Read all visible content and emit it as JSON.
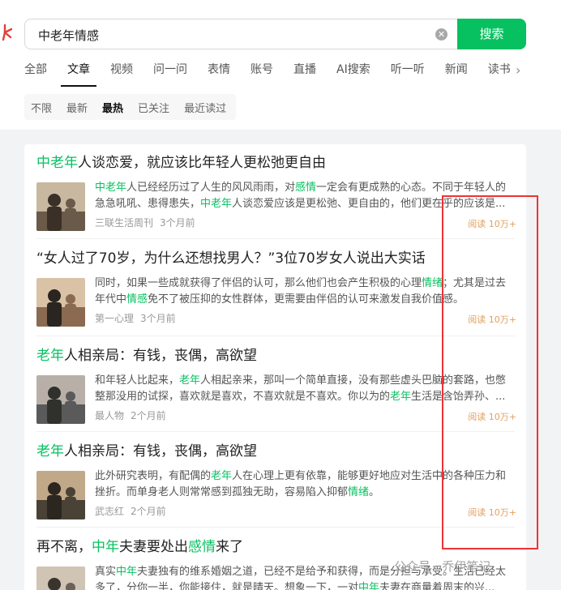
{
  "search": {
    "query": "中老年情感",
    "button_label": "搜索"
  },
  "tabs": [
    {
      "label": "全部",
      "active": false
    },
    {
      "label": "文章",
      "active": true
    },
    {
      "label": "视频",
      "active": false
    },
    {
      "label": "问一问",
      "active": false
    },
    {
      "label": "表情",
      "active": false
    },
    {
      "label": "账号",
      "active": false
    },
    {
      "label": "直播",
      "active": false
    },
    {
      "label": "AI搜索",
      "active": false
    },
    {
      "label": "听一听",
      "active": false
    },
    {
      "label": "新闻",
      "active": false
    },
    {
      "label": "读书",
      "active": false
    }
  ],
  "filters": [
    {
      "label": "不限",
      "active": false
    },
    {
      "label": "最新",
      "active": false
    },
    {
      "label": "最热",
      "active": true
    },
    {
      "label": "已关注",
      "active": false
    },
    {
      "label": "最近读过",
      "active": false
    }
  ],
  "results": [
    {
      "title": [
        {
          "t": "中老年",
          "hl": true
        },
        {
          "t": "人谈恋爱，就应该比年轻人更松弛更自由",
          "hl": false
        }
      ],
      "snippet": [
        {
          "t": "中老年",
          "hl": true
        },
        {
          "t": "人已经经历过了人生的风风雨雨，对",
          "hl": false
        },
        {
          "t": "感情",
          "hl": true
        },
        {
          "t": "一定会有更成熟的心态。不同于年轻人的急急吼吼、患得患失，",
          "hl": false
        },
        {
          "t": "中老年",
          "hl": true
        },
        {
          "t": "人谈恋爱应该是更松弛、更自由的，他们更在乎的应该是...",
          "hl": false
        }
      ],
      "source": "三联生活周刊",
      "time": "3个月前",
      "reads": "阅读 10万+"
    },
    {
      "title": [
        {
          "t": "“女人过了70岁，为什么还想找男人？”3位70岁女人说出大实话",
          "hl": false
        }
      ],
      "snippet": [
        {
          "t": "同时，如果一些成就获得了伴侣的认可，那么他们也会产生积极的心理",
          "hl": false
        },
        {
          "t": "情绪",
          "hl": true
        },
        {
          "t": "；尤其是过去年代中",
          "hl": false
        },
        {
          "t": "情感",
          "hl": true
        },
        {
          "t": "免不了被压抑的女性群体，更需要由伴侣的认可来激发自我价值感。",
          "hl": false
        }
      ],
      "source": "第一心理",
      "time": "3个月前",
      "reads": "阅读 10万+"
    },
    {
      "title": [
        {
          "t": "老年",
          "hl": true
        },
        {
          "t": "人相亲局：有钱，丧偶，高欲望",
          "hl": false
        }
      ],
      "snippet": [
        {
          "t": "和年轻人比起来，",
          "hl": false
        },
        {
          "t": "老年",
          "hl": true
        },
        {
          "t": "人相起亲来，那叫一个简单直接，没有那些虚头巴脑的套路，也憋整那没用的试探，喜欢就是喜欢，不喜欢就是不喜欢。你以为的",
          "hl": false
        },
        {
          "t": "老年",
          "hl": true
        },
        {
          "t": "生活是含饴弄孙、...",
          "hl": false
        }
      ],
      "source": "最人物",
      "time": "2个月前",
      "reads": "阅读 10万+"
    },
    {
      "title": [
        {
          "t": "老年",
          "hl": true
        },
        {
          "t": "人相亲局：有钱，丧偶，高欲望",
          "hl": false
        }
      ],
      "snippet": [
        {
          "t": "此外研究表明，有配偶的",
          "hl": false
        },
        {
          "t": "老年",
          "hl": true
        },
        {
          "t": "人在心理上更有依靠，能够更好地应对生活中的各种压力和挫折。而单身老人则常常感到孤独无助，容易陷入抑郁",
          "hl": false
        },
        {
          "t": "情绪",
          "hl": true
        },
        {
          "t": "。",
          "hl": false
        }
      ],
      "source": "武志红",
      "time": "2个月前",
      "reads": "阅读 10万+"
    },
    {
      "title": [
        {
          "t": "再不离，",
          "hl": false
        },
        {
          "t": "中年",
          "hl": true
        },
        {
          "t": "夫妻要处出",
          "hl": false
        },
        {
          "t": "感情",
          "hl": true
        },
        {
          "t": "来了",
          "hl": false
        }
      ],
      "snippet": [
        {
          "t": "真实",
          "hl": false
        },
        {
          "t": "中年",
          "hl": true
        },
        {
          "t": "夫妻独有的维系婚姻之道，已经不是给予和获得，而是分担与承受。生活已经太多了，分你一半，你能接住，就是晴天。想象一下，一对",
          "hl": false
        },
        {
          "t": "中年",
          "hl": true
        },
        {
          "t": "夫妻在商量着周末的兴...",
          "hl": false
        }
      ],
      "source": "",
      "time": "",
      "reads": ""
    }
  ],
  "watermark": "公众号 · 乔伊笔记"
}
